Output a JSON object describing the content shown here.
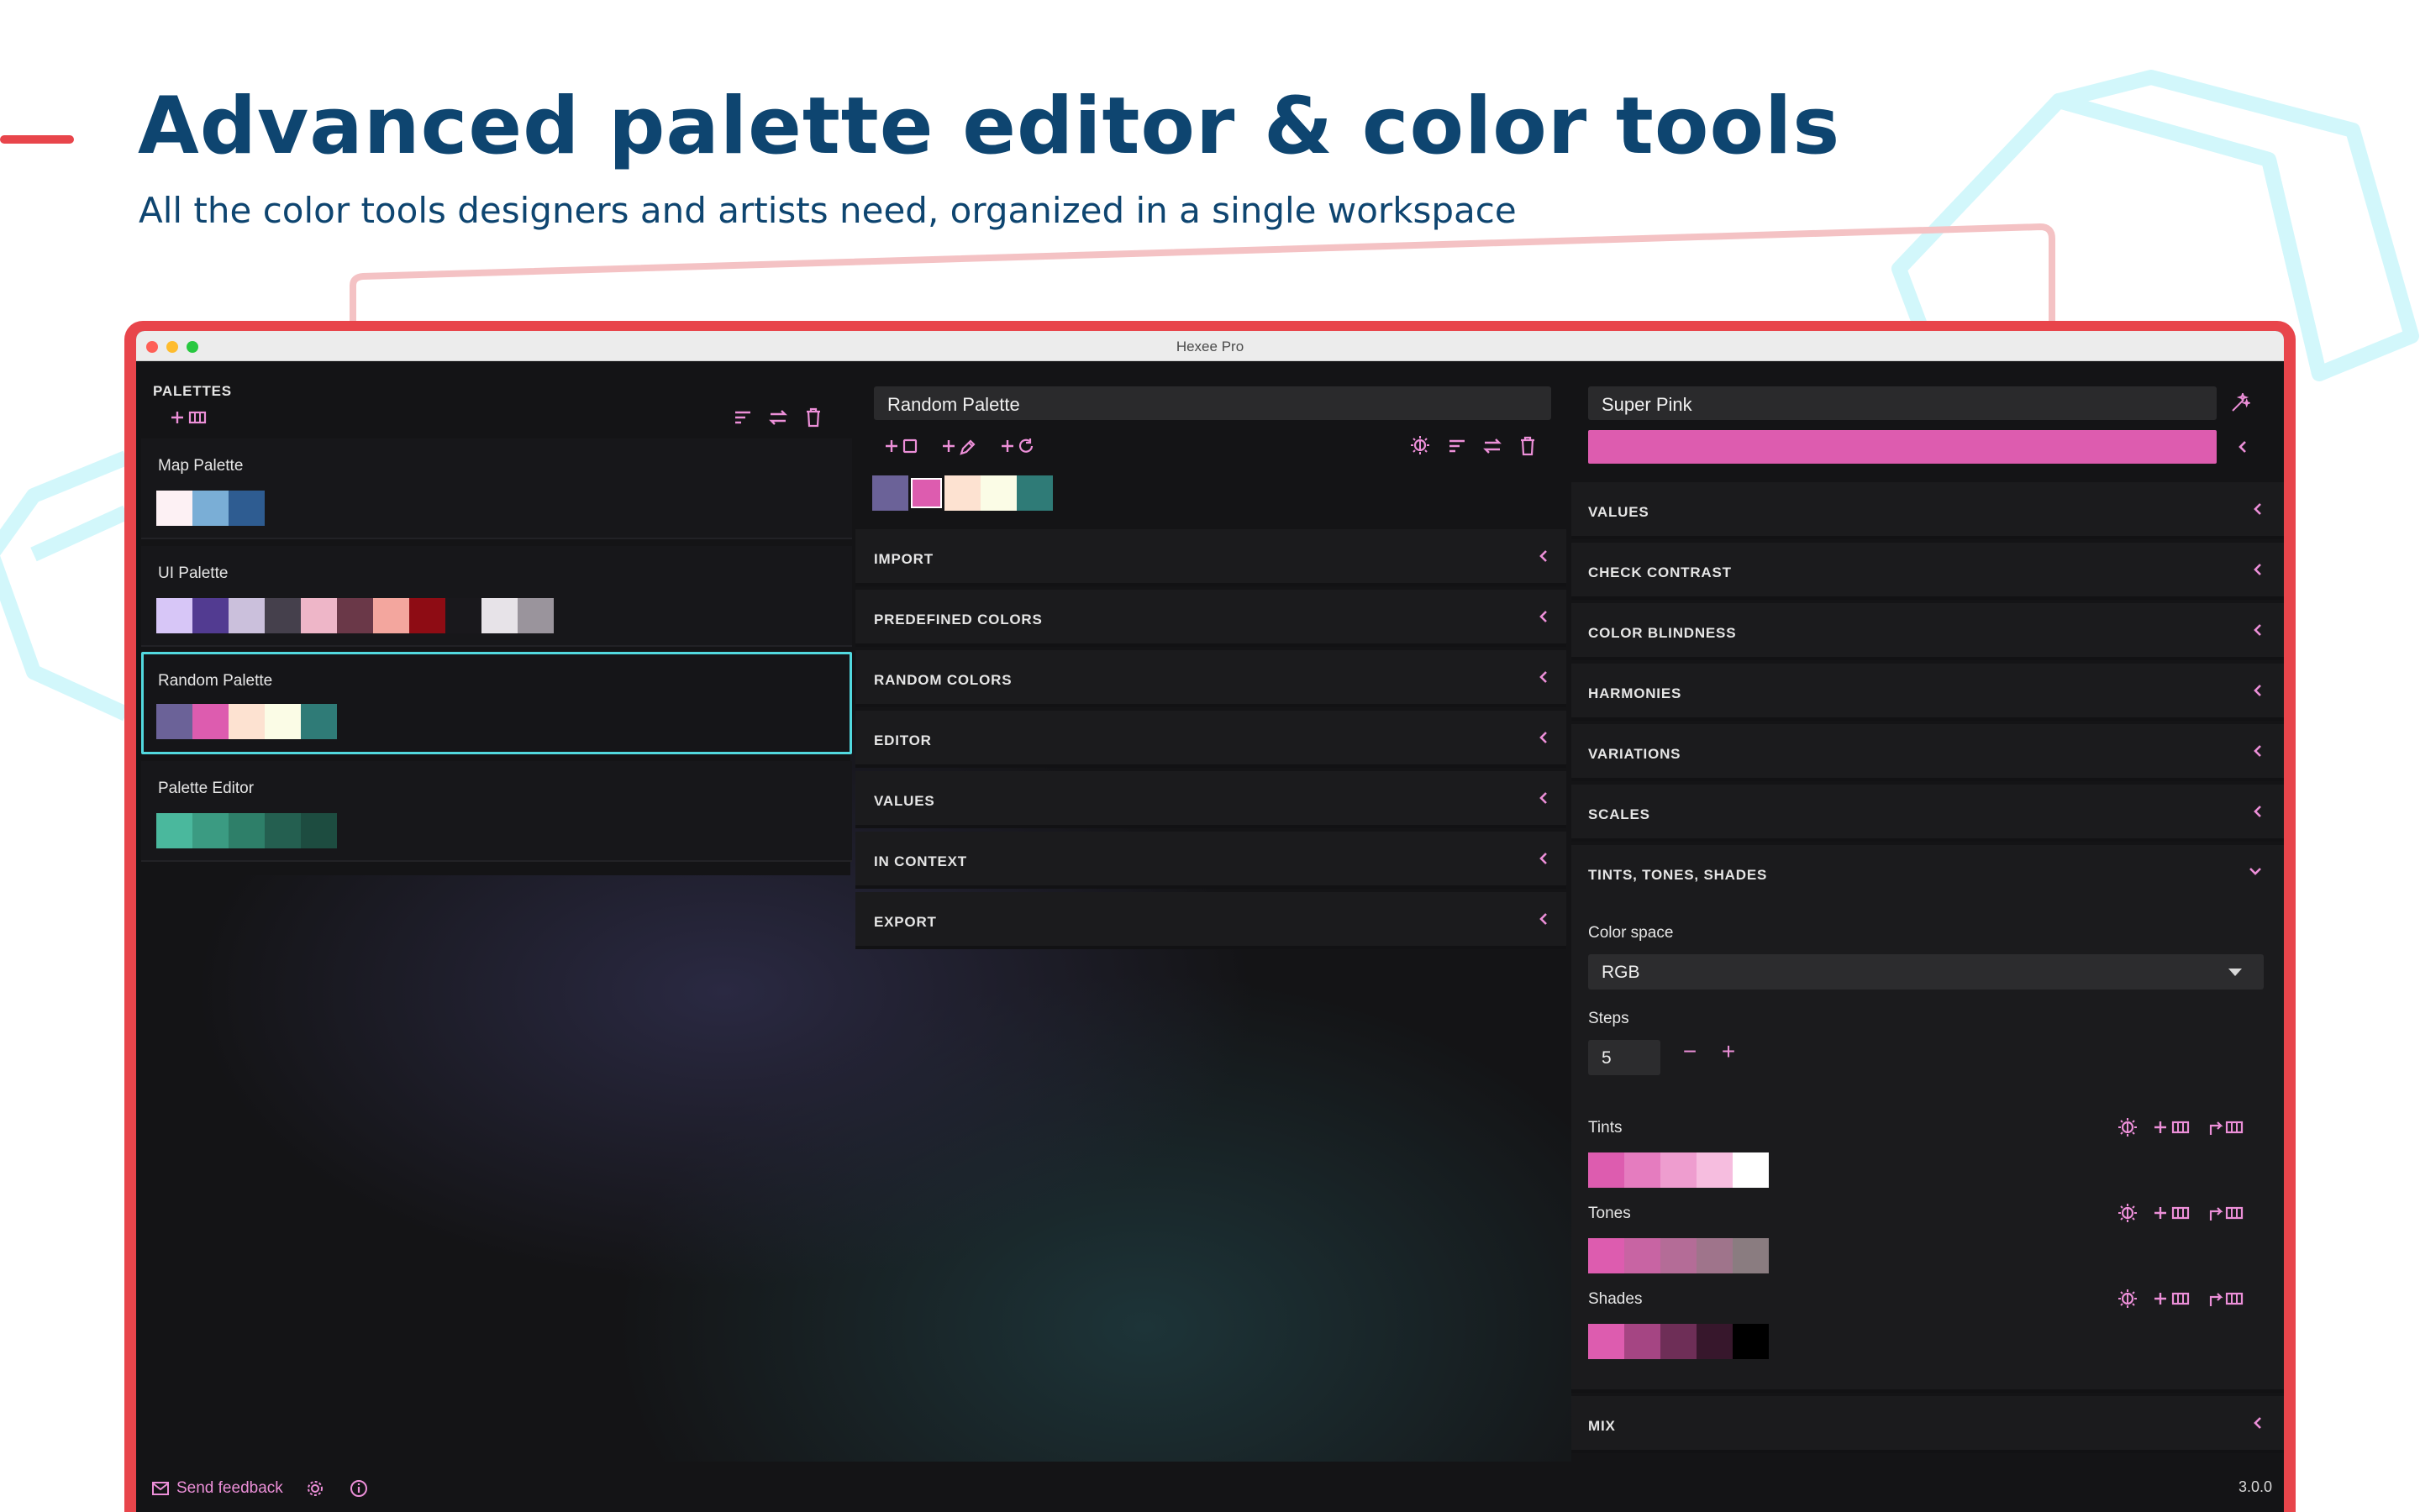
{
  "hero": {
    "title": "Advanced palette editor & color tools",
    "subtitle": "All the color tools designers and artists need, organized in a single workspace"
  },
  "window": {
    "title": "Hexee Pro"
  },
  "palettes": {
    "heading": "PALETTES",
    "items": [
      {
        "name": "Map Palette",
        "colors": [
          "#fdf1f4",
          "#7aaed6",
          "#2e5c91"
        ]
      },
      {
        "name": "UI Palette",
        "colors": [
          "#d7c6f7",
          "#523b91",
          "#cbc0dc",
          "#45404c",
          "#eeb6c8",
          "#6a3848",
          "#f3a69e",
          "#8e0c14",
          "#19181c",
          "#e7e3e8",
          "#9a949c"
        ]
      },
      {
        "name": "Random Palette",
        "colors": [
          "#6b6298",
          "#dd5caf",
          "#fde2d1",
          "#fbfce6",
          "#2f7b77"
        ],
        "selected": true
      },
      {
        "name": "Palette Editor",
        "colors": [
          "#4ab89d",
          "#3b9b82",
          "#2e7f69",
          "#245f50",
          "#1d4c40"
        ]
      }
    ]
  },
  "editor": {
    "palette_name": "Random Palette",
    "colors": [
      "#6b6298",
      "#dd5caf",
      "#fde2d1",
      "#fbfce6",
      "#2f7b77"
    ],
    "selected_index": 1,
    "sections": [
      "IMPORT",
      "PREDEFINED COLORS",
      "RANDOM COLORS",
      "EDITOR",
      "VALUES",
      "IN CONTEXT",
      "EXPORT"
    ]
  },
  "color": {
    "name": "Super Pink",
    "hex": "#dd5caf",
    "sections": [
      "VALUES",
      "CHECK CONTRAST",
      "COLOR BLINDNESS",
      "HARMONIES",
      "VARIATIONS",
      "SCALES"
    ],
    "expanded_section": "TINTS, TONES, SHADES",
    "color_space_label": "Color space",
    "color_space_value": "RGB",
    "steps_label": "Steps",
    "steps_value": "5",
    "minus": "−",
    "plus": "+",
    "tints": {
      "label": "Tints",
      "colors": [
        "#dd5caf",
        "#e57cbf",
        "#ee9dcf",
        "#f6bddf",
        "#ffffff"
      ]
    },
    "tones": {
      "label": "Tones",
      "colors": [
        "#dd5caf",
        "#c864a3",
        "#b46c97",
        "#9f748b",
        "#8a7c80"
      ]
    },
    "shades": {
      "label": "Shades",
      "colors": [
        "#dd5caf",
        "#a54583",
        "#6e2e57",
        "#37172c",
        "#000000"
      ]
    },
    "last_section": "MIX"
  },
  "footer": {
    "feedback": "Send feedback",
    "version": "3.0.0"
  },
  "colors": {
    "accent": "#ec8fd8",
    "frame": "#e8454b",
    "selected_border": "#52d9df",
    "heading": "#0e4570"
  }
}
